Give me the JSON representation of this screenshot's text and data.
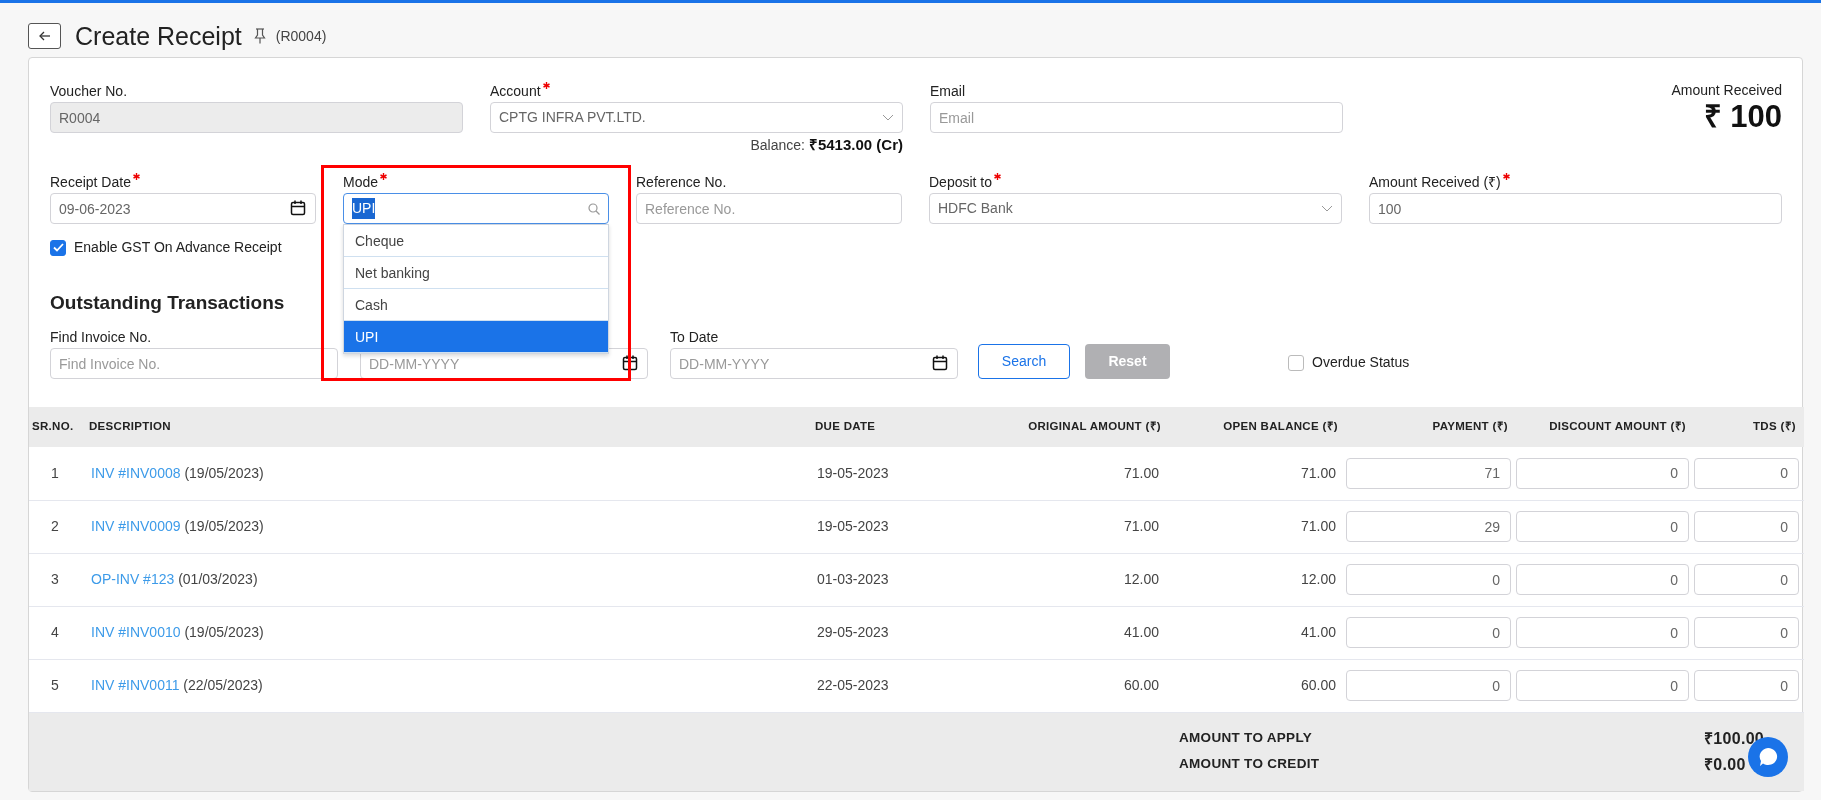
{
  "header": {
    "title": "Create Receipt",
    "code": "(R0004)"
  },
  "voucher_no": {
    "label": "Voucher No.",
    "value": "R0004",
    "disabled": true
  },
  "account": {
    "label": "Account",
    "required": true,
    "value": "CPTG INFRA PVT.LTD.",
    "balance_label": "Balance:",
    "balance": "₹5413.00 (Cr)"
  },
  "email": {
    "label": "Email",
    "placeholder": "Email"
  },
  "amount_summary": {
    "label": "Amount Received",
    "value": "₹ 100"
  },
  "receipt_date": {
    "label": "Receipt Date",
    "required": true,
    "value": "09-06-2023"
  },
  "mode": {
    "label": "Mode",
    "required": true,
    "value": "UPI",
    "highlighted": true,
    "options": [
      {
        "label": "Cheque",
        "selected": false
      },
      {
        "label": "Net banking",
        "selected": false
      },
      {
        "label": "Cash",
        "selected": false
      },
      {
        "label": "UPI",
        "selected": true
      }
    ]
  },
  "reference_no": {
    "label": "Reference No.",
    "placeholder": "Reference No."
  },
  "deposit_to": {
    "label": "Deposit to",
    "required": true,
    "value": "HDFC Bank"
  },
  "amount_received": {
    "label": "Amount Received (₹)",
    "required": true,
    "value": "100"
  },
  "gst_option": {
    "label": "Enable GST On Advance Receipt",
    "checked": true
  },
  "outstanding": {
    "title": "Outstanding Transactions",
    "find_invoice": {
      "label": "Find Invoice No.",
      "placeholder": "Find Invoice No."
    },
    "from_date": {
      "placeholder": "DD-MM-YYYY"
    },
    "to_date": {
      "label": "To Date",
      "placeholder": "DD-MM-YYYY"
    },
    "search_button": {
      "label": "Search"
    },
    "reset_button": {
      "label": "Reset",
      "disabled": true
    },
    "overdue": {
      "label": "Overdue Status",
      "checked": false
    }
  },
  "table": {
    "columns": [
      "SR.NO.",
      "DESCRIPTION",
      "DUE DATE",
      "ORIGINAL AMOUNT (₹)",
      "OPEN BALANCE (₹)",
      "PAYMENT (₹)",
      "DISCOUNT AMOUNT (₹)",
      "TDS (₹)"
    ],
    "rows": [
      {
        "sr": "1",
        "invoice": "INV #INV0008",
        "date": "(19/05/2023)",
        "due_date": "19-05-2023",
        "original": "71.00",
        "open_balance": "71.00",
        "payment": "71",
        "discount": "0",
        "tds": "0"
      },
      {
        "sr": "2",
        "invoice": "INV #INV0009",
        "date": "(19/05/2023)",
        "due_date": "19-05-2023",
        "original": "71.00",
        "open_balance": "71.00",
        "payment": "29",
        "discount": "0",
        "tds": "0"
      },
      {
        "sr": "3",
        "invoice": "OP-INV #123",
        "date": "(01/03/2023)",
        "due_date": "01-03-2023",
        "original": "12.00",
        "open_balance": "12.00",
        "payment": "0",
        "discount": "0",
        "tds": "0"
      },
      {
        "sr": "4",
        "invoice": "INV #INV0010",
        "date": "(19/05/2023)",
        "due_date": "29-05-2023",
        "original": "41.00",
        "open_balance": "41.00",
        "payment": "0",
        "discount": "0",
        "tds": "0"
      },
      {
        "sr": "5",
        "invoice": "INV #INV0011",
        "date": "(22/05/2023)",
        "due_date": "22-05-2023",
        "original": "60.00",
        "open_balance": "60.00",
        "payment": "0",
        "discount": "0",
        "tds": "0"
      }
    ],
    "totals": [
      {
        "label": "AMOUNT TO APPLY",
        "value": "₹100.00"
      },
      {
        "label": "AMOUNT TO CREDIT",
        "value": "₹0.00"
      }
    ]
  }
}
